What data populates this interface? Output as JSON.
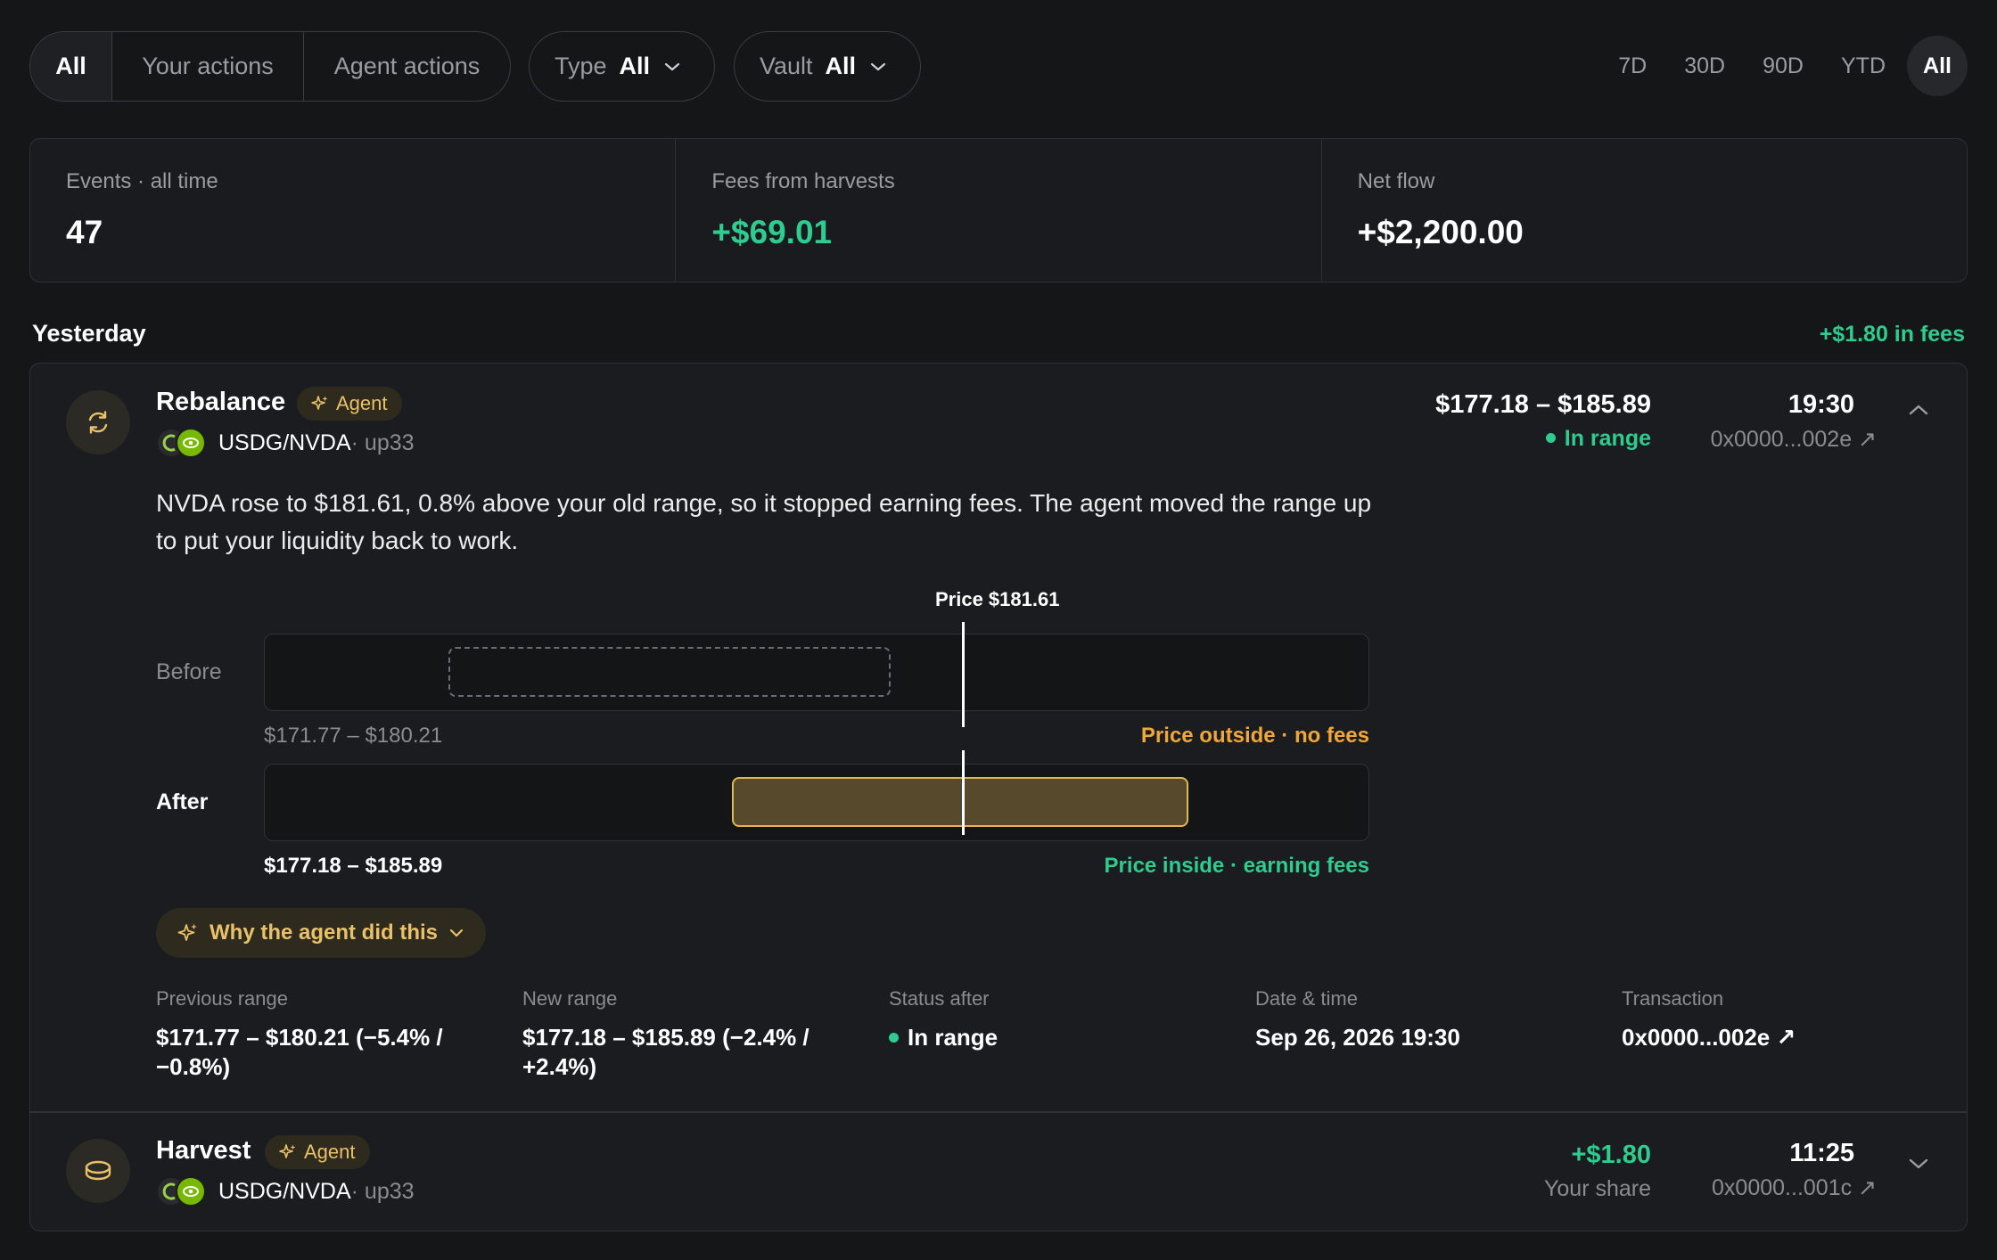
{
  "filters": {
    "actor_tabs": [
      "All",
      "Your actions",
      "Agent actions"
    ],
    "actor_active": "All",
    "type": {
      "label": "Type",
      "value": "All"
    },
    "vault": {
      "label": "Vault",
      "value": "All"
    },
    "time_ranges": [
      "7D",
      "30D",
      "90D",
      "YTD",
      "All"
    ],
    "time_active": "All"
  },
  "stats": [
    {
      "label": "Events · all time",
      "value": "47"
    },
    {
      "label": "Fees from harvests",
      "value": "+$69.01"
    },
    {
      "label": "Net flow",
      "value": "+$2,200.00"
    }
  ],
  "section": {
    "title": "Yesterday",
    "fees": "+$1.80 in fees"
  },
  "events": [
    {
      "title": "Rebalance",
      "badge": "Agent",
      "pair": "USDG/NVDA",
      "pair_sub": " · up33",
      "amount": "$177.18 – $185.89",
      "status": "In range",
      "time": "19:30",
      "tx": "0x0000...002e ↗",
      "description": "NVDA rose to $181.61, 0.8% above your old range, so it stopped earning fees. The agent moved the range up to put your liquidity back to work.",
      "viz": {
        "price_label": "Price $181.61",
        "price": 181.61,
        "before_label": "Before",
        "after_label": "After",
        "before_range_text": "$171.77 – $180.21",
        "after_range_text": "$177.18 – $185.89",
        "before_status": "Price outside · no fees",
        "after_status": "Price inside · earning fees"
      },
      "why_button": "Why the agent did this",
      "details": [
        {
          "label": "Previous range",
          "value": "$171.77 – $180.21 (−5.4% / −0.8%)"
        },
        {
          "label": "New range",
          "value": "$177.18 – $185.89 (−2.4% / +2.4%)"
        },
        {
          "label": "Status after",
          "value": "In range"
        },
        {
          "label": "Date & time",
          "value": "Sep 26, 2026 19:30"
        },
        {
          "label": "Transaction",
          "value": "0x0000...002e ↗"
        }
      ]
    },
    {
      "title": "Harvest",
      "badge": "Agent",
      "pair": "USDG/NVDA",
      "pair_sub": " · up33",
      "amount": "+$1.80",
      "sub": "Your share",
      "time": "11:25",
      "tx": "0x0000...001c ↗"
    }
  ],
  "colors": {
    "background": "#151618",
    "accent_green": "#2ecc8f",
    "agent_gold": "#e8c16a",
    "warning_orange": "#f0a73a"
  }
}
